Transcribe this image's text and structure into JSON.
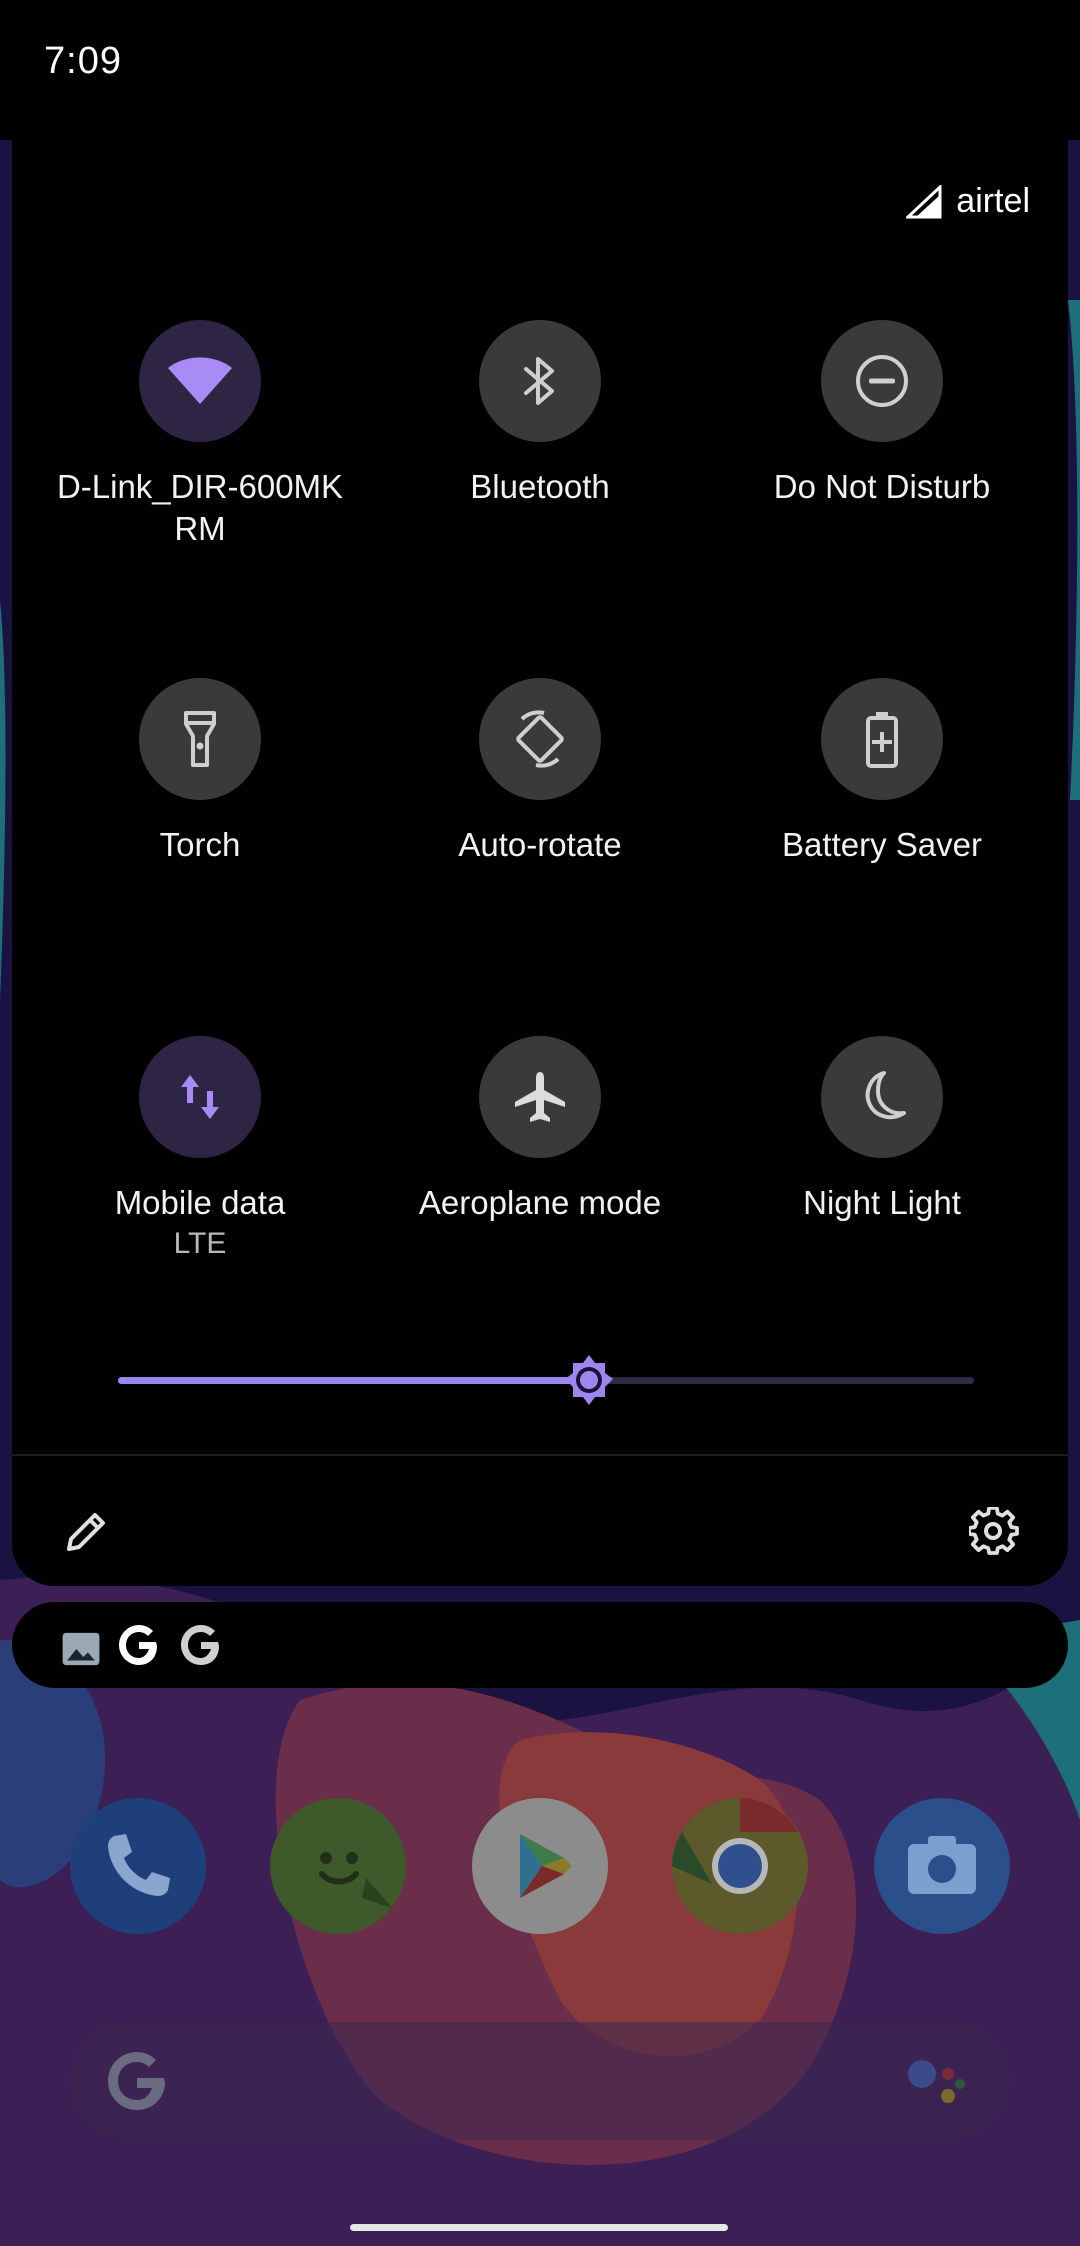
{
  "status_bar": {
    "time": "7:09"
  },
  "carrier": {
    "name": "airtel",
    "icon": "signal-icon"
  },
  "tiles": [
    {
      "label": "D-Link_DIR-600MK RM",
      "sub": "",
      "icon": "wifi-icon",
      "active": true
    },
    {
      "label": "Bluetooth",
      "sub": "",
      "icon": "bluetooth-icon",
      "active": false
    },
    {
      "label": "Do Not Disturb",
      "sub": "",
      "icon": "do-not-disturb-icon",
      "active": false
    },
    {
      "label": "Torch",
      "sub": "",
      "icon": "torch-icon",
      "active": false
    },
    {
      "label": "Auto-rotate",
      "sub": "",
      "icon": "auto-rotate-icon",
      "active": false
    },
    {
      "label": "Battery Saver",
      "sub": "",
      "icon": "battery-saver-icon",
      "active": false
    },
    {
      "label": "Mobile data",
      "sub": "LTE",
      "icon": "mobile-data-icon",
      "active": true
    },
    {
      "label": "Aeroplane mode",
      "sub": "",
      "icon": "aeroplane-icon",
      "active": false
    },
    {
      "label": "Night Light",
      "sub": "",
      "icon": "night-light-icon",
      "active": false
    }
  ],
  "brightness": {
    "level": 0.55,
    "icon": "brightness-icon"
  },
  "footer": {
    "edit_icon": "pencil-icon",
    "settings_icon": "gear-icon"
  },
  "notifications": {
    "icons": [
      "image-icon",
      "google-icon",
      "google-icon"
    ]
  },
  "dock": {
    "apps": [
      {
        "name": "phone",
        "icon": "phone-icon"
      },
      {
        "name": "messages",
        "icon": "messages-icon"
      },
      {
        "name": "play-store",
        "icon": "play-store-icon"
      },
      {
        "name": "chrome",
        "icon": "chrome-icon"
      },
      {
        "name": "camera",
        "icon": "camera-icon"
      }
    ]
  },
  "colors": {
    "accent": "#9e86ef",
    "tile_off": "#3a3a3c",
    "tile_on": "#2e2545",
    "panel": "#000000"
  }
}
